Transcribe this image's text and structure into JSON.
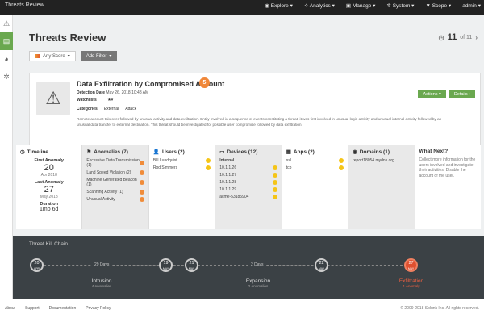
{
  "topbar": {
    "breadcrumb": "Threats Review",
    "nav": [
      "Explore",
      "Analytics",
      "Manage",
      "System",
      "Scope",
      "admin"
    ]
  },
  "sidebar_icons": [
    "warning-icon",
    "threats-icon",
    "analytics-icon",
    "gear-icon"
  ],
  "page": {
    "title": "Threats Review",
    "count": "11",
    "count_suffix": "of 11"
  },
  "filters": {
    "any_score": "Any Score",
    "add_filter": "Add Filter"
  },
  "threat": {
    "name": "Data Exfiltration by Compromised Account",
    "score": "5",
    "detection_label": "Detection Date",
    "detection_date": "May 26, 2018 10:48 AM",
    "watchlists_label": "Watchlists",
    "categories_label": "Categories",
    "categories": [
      "External",
      "Attack"
    ],
    "description": "Remote account takeover followed by unusual activity and data exfiltration. Entity involved in a sequence of events constituting a threat: it was first involved in unusual login activity and unusual internal activity followed by an unusual data transfer to external destination. This threat should be investigated for possible user compromise followed by data exfiltration.",
    "actions_label": "Actions",
    "details_label": "Details"
  },
  "timeline": {
    "header": "Timeline",
    "first_label": "First Anomaly",
    "first_day": "20",
    "first_month": "Apr 2018",
    "last_label": "Last Anomaly",
    "last_day": "27",
    "last_month": "May 2018",
    "duration_label": "Duration",
    "duration": "1mo 6d"
  },
  "anomalies": {
    "header": "Anomalies (7)",
    "items": [
      {
        "label": "Excessive Data Transmission (1)"
      },
      {
        "label": "Land Speed Violation (2)"
      },
      {
        "label": "Machine Generated Beacon (1)"
      },
      {
        "label": "Scanning Activity (1)"
      },
      {
        "label": "Unusual Activity"
      }
    ]
  },
  "users": {
    "header": "Users (2)",
    "items": [
      "Bill Lundquist",
      "Rod Simmers"
    ]
  },
  "devices": {
    "header": "Devices (12)",
    "group": "Internal",
    "items": [
      "10.1.1.26",
      "10.1.1.27",
      "10.1.1.28",
      "10.1.1.29",
      "acme-53185904"
    ]
  },
  "apps": {
    "header": "Apps (2)",
    "items": [
      "ssl",
      "tcp"
    ]
  },
  "domains": {
    "header": "Domains (1)",
    "items": [
      "report18054.mydns.org"
    ]
  },
  "whatnext": {
    "header": "What Next?",
    "text": "Collect more information for the users involved and investigate their activities. Disable the account of the user."
  },
  "killchain": {
    "title": "Threat Kill Chain",
    "nodes": [
      {
        "day": "20",
        "mon": "APR"
      },
      {
        "day": "19",
        "mon": "MAY"
      },
      {
        "day": "21",
        "mon": "MAY"
      },
      {
        "day": "22",
        "mon": "MAY"
      },
      {
        "day": "27",
        "mon": "MAY"
      }
    ],
    "gaps": [
      "29 Days",
      "2 Days"
    ],
    "phases": [
      {
        "name": "Intrusion",
        "sub": "4 Anomalies"
      },
      {
        "name": "Expansion",
        "sub": "2 Anomalies"
      },
      {
        "name": "Exfiltration",
        "sub": "1 Anomaly"
      }
    ]
  },
  "footer": {
    "links": [
      "About",
      "Support",
      "Documentation",
      "Privacy Policy"
    ],
    "copyright": "© 2009-2018 Splunk Inc. All rights reserved."
  },
  "colors": {
    "accent_green": "#6aa84f",
    "score_orange": "#f0883a",
    "exfil_red": "#e05030",
    "dot_yellow": "#f5c518"
  }
}
